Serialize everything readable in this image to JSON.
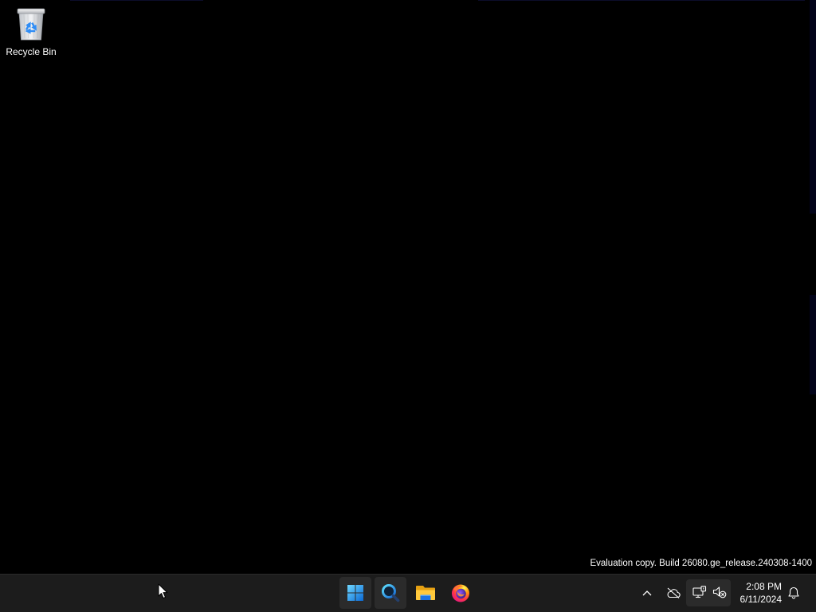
{
  "desktop": {
    "background_color": "#000000",
    "icons": [
      {
        "label": "Recycle Bin",
        "icon": "recycle-bin-icon"
      }
    ]
  },
  "watermark": {
    "text": "Evaluation copy. Build 26080.ge_release.240308-1400"
  },
  "taskbar": {
    "background_color": "#1c1c1c",
    "pinned": [
      {
        "icon": "windows-start-icon",
        "active": true
      },
      {
        "icon": "search-icon",
        "active": true
      },
      {
        "icon": "file-explorer-icon",
        "active": false
      },
      {
        "icon": "firefox-icon",
        "active": false
      }
    ],
    "tray": {
      "icons": [
        "chevron-up-icon",
        "onedrive-offline-icon",
        "network-disconnected-icon",
        "volume-muted-icon",
        "bell-icon"
      ],
      "time": "2:08 PM",
      "date": "6/11/2024"
    }
  },
  "colors": {
    "accent": "#0078d4",
    "text": "#ffffff"
  }
}
